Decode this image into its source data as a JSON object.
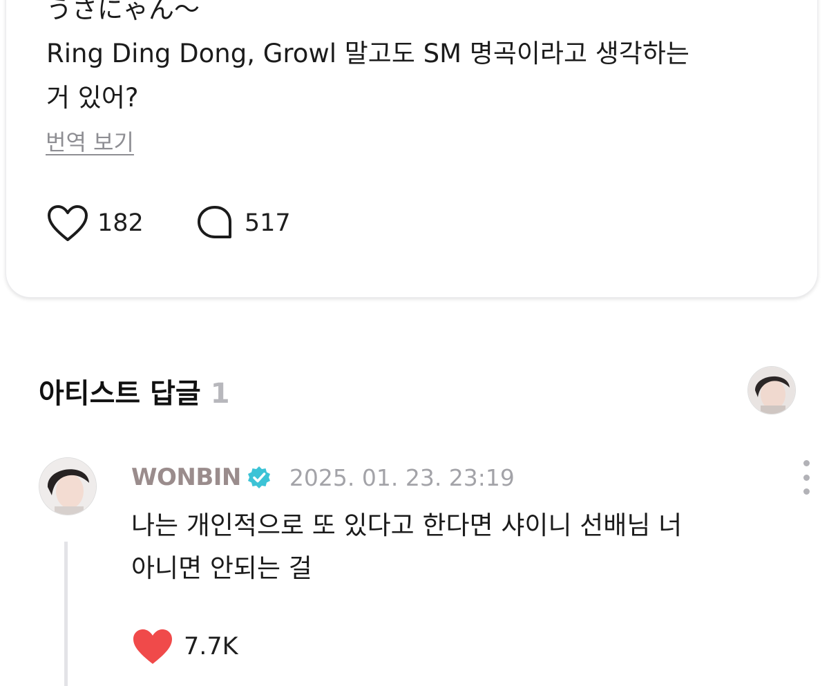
{
  "post": {
    "lines": [
      "うさにゃん〜",
      "Ring Ding Dong, Growl 말고도 SM 명곡이라고 생각하는",
      "거 있어?"
    ],
    "translate_label": "번역 보기",
    "like_icon": "heart-outline-icon",
    "likes": "182",
    "comment_icon": "speech-bubble-icon",
    "comments": "517"
  },
  "section": {
    "title": "아티스트 답글",
    "count": "1"
  },
  "reply": {
    "author": "WONBIN",
    "verified_icon": "verified-badge-icon",
    "verified_color": "#3cc3d6",
    "timestamp": "2025. 01. 23. 23:19",
    "lines": [
      "나는 개인적으로 또 있다고 한다면 샤이니 선배님 너",
      "아니면 안되는 걸"
    ],
    "like_icon": "heart-filled-icon",
    "like_color": "#f04a4a",
    "likes": "7.7K"
  }
}
